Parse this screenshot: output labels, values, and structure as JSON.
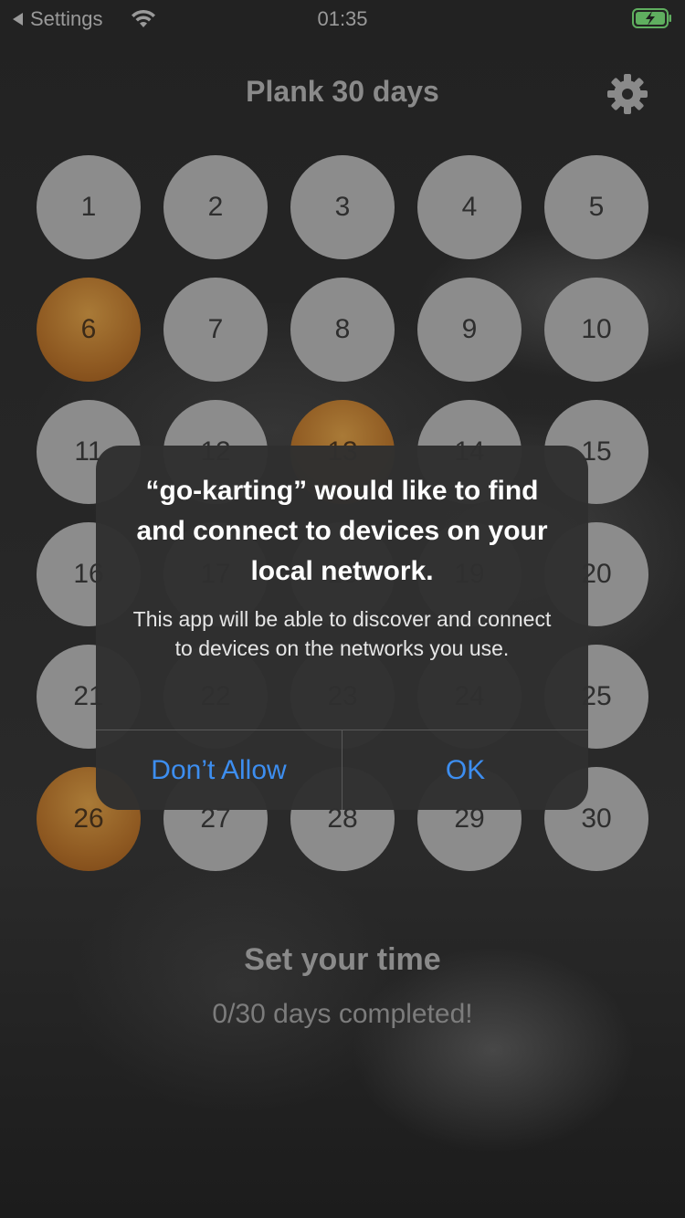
{
  "status_bar": {
    "back_label": "Settings",
    "time": "01:35"
  },
  "header": {
    "title": "Plank 30 days",
    "settings_icon": "gear-icon"
  },
  "days": [
    {
      "label": "1",
      "completed": false
    },
    {
      "label": "2",
      "completed": false
    },
    {
      "label": "3",
      "completed": false
    },
    {
      "label": "4",
      "completed": false
    },
    {
      "label": "5",
      "completed": false
    },
    {
      "label": "6",
      "completed": true
    },
    {
      "label": "7",
      "completed": false
    },
    {
      "label": "8",
      "completed": false
    },
    {
      "label": "9",
      "completed": false
    },
    {
      "label": "10",
      "completed": false
    },
    {
      "label": "11",
      "completed": false
    },
    {
      "label": "12",
      "completed": false
    },
    {
      "label": "13",
      "completed": true
    },
    {
      "label": "14",
      "completed": false
    },
    {
      "label": "15",
      "completed": false
    },
    {
      "label": "16",
      "completed": false
    },
    {
      "label": "17",
      "completed": false
    },
    {
      "label": "18",
      "completed": false
    },
    {
      "label": "19",
      "completed": false
    },
    {
      "label": "20",
      "completed": false
    },
    {
      "label": "21",
      "completed": false
    },
    {
      "label": "22",
      "completed": false
    },
    {
      "label": "23",
      "completed": false
    },
    {
      "label": "24",
      "completed": false
    },
    {
      "label": "25",
      "completed": false
    },
    {
      "label": "26",
      "completed": true
    },
    {
      "label": "27",
      "completed": false
    },
    {
      "label": "28",
      "completed": false
    },
    {
      "label": "29",
      "completed": false
    },
    {
      "label": "30",
      "completed": false
    }
  ],
  "footer": {
    "set_time_label": "Set your time",
    "progress_text": "0/30 days completed!"
  },
  "alert": {
    "title": "“go-karting” would like to find and connect to devices on your local network.",
    "message": "This app will be able to discover and connect to devices on the networks you use.",
    "deny_label": "Don’t Allow",
    "ok_label": "OK"
  },
  "colors": {
    "day_default": "#8c8c8c",
    "day_completed": "#a97a37",
    "alert_button": "#3d8ef0"
  }
}
